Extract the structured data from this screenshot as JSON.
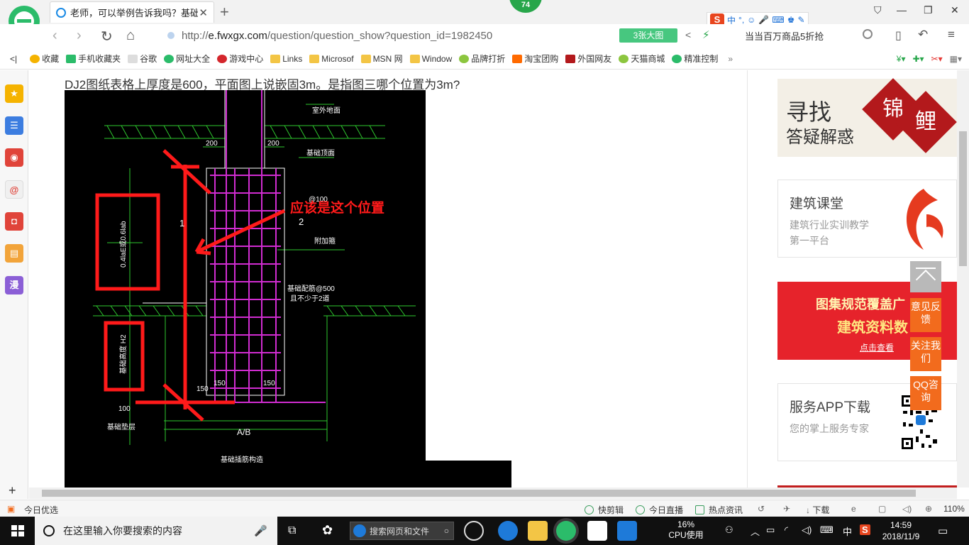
{
  "browser": {
    "tab_title": "老师，可以举例告诉我吗？基础...",
    "notification_count": "74",
    "ime": {
      "mode": "中"
    },
    "url_prefix": "http://",
    "url_domain": "e.fwxgx.com",
    "url_path": "/question/question_show?question_id=1982450",
    "bigimage_label": "3张大图",
    "promo_text": "当当百万商品5折抢"
  },
  "bookmarks": [
    {
      "label": "收藏",
      "icon": "star-icon"
    },
    {
      "label": "手机收藏夹",
      "icon": "phone-icon"
    },
    {
      "label": "谷歌",
      "icon": "page-icon"
    },
    {
      "label": "网址大全",
      "icon": "globe-icon"
    },
    {
      "label": "游戏中心",
      "icon": "game-icon"
    },
    {
      "label": "Links",
      "icon": "folder-icon"
    },
    {
      "label": "Microsof",
      "icon": "folder-icon"
    },
    {
      "label": "MSN 网",
      "icon": "folder-icon"
    },
    {
      "label": "Window",
      "icon": "folder-icon"
    },
    {
      "label": "品牌打折",
      "icon": "leaf-icon"
    },
    {
      "label": "淘宝团购",
      "icon": "taobao-icon"
    },
    {
      "label": "外国网友",
      "icon": "flag-icon"
    },
    {
      "label": "天猫商城",
      "icon": "leaf-icon"
    },
    {
      "label": "精准控制",
      "icon": "chat-icon"
    }
  ],
  "sidebar": {
    "manga_label": "漫"
  },
  "main": {
    "question": "DJ2图纸表格上厚度是600，平面图上说嵌固3m。是指图三哪个位置为3m?",
    "drawing": {
      "annotation": "应该是这个位置",
      "dim_200_left": "200",
      "dim_200_right": "200",
      "dim_150_a": "150",
      "dim_150_b": "150",
      "dim_150_c": "150",
      "dim_100": "100",
      "label_2": "2",
      "label_1": "1",
      "label_ab": "A/B",
      "note_top": "室外地面",
      "note_top2": "基础顶面",
      "note_mid": "附加箍",
      "note_bottom": "基础垫层",
      "note_low": "基础配筋@500",
      "note_low2": "且不少于2道",
      "vertical_text_1": "0.4laE或0.6lab",
      "vertical_text_2": "基础高度 H2",
      "dim_top_left": "@100",
      "bottom_caption": "基础插筋构造"
    }
  },
  "ads": {
    "ad1_line1": "寻找",
    "ad1_line2": "答疑解惑",
    "ad1_badge1": "锦",
    "ad1_badge2": "鲤",
    "ad2_title": "建筑课堂",
    "ad2_sub": "建筑行业实训教学第一平台",
    "ad3_line1": "图集规范覆盖广",
    "ad3_line2": "建筑资料数",
    "ad3_link": "点击查看",
    "ad4_title": "服务APP下载",
    "ad4_sub": "您的掌上服务专家"
  },
  "floats": {
    "feedback": "意见反馈",
    "follow": "关注我们",
    "qq": "QQ咨询"
  },
  "statusbar": {
    "left": "今日优选",
    "items": [
      "快剪辑",
      "今日直播",
      "热点资讯",
      "下载"
    ],
    "zoom": "110%"
  },
  "taskbar": {
    "search_placeholder": "在这里输入你要搜索的内容",
    "addr_placeholder": "搜索网页和文件",
    "cpu_percent": "16%",
    "cpu_label": "CPU使用",
    "ime": "中",
    "time": "14:59",
    "date": "2018/11/9"
  },
  "colors": {
    "accent": "#f26b1d",
    "drawing_bg": "#000000",
    "rebar": "#d02cd0",
    "markup": "#ff1a1a",
    "green_line": "#2ec82e"
  }
}
